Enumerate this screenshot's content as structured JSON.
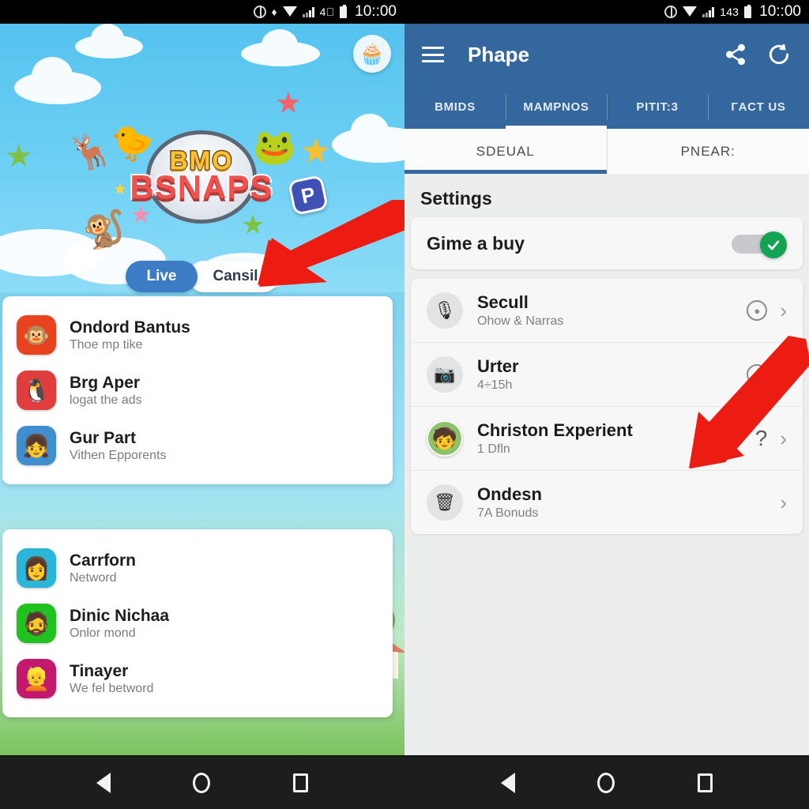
{
  "left": {
    "statusbar": {
      "network": "4⃣",
      "time": "10::00",
      "icons": [
        "globe-icon",
        "bluetooth-icon",
        "wifi-icon",
        "signal-icon"
      ]
    },
    "avatar_icon": "cupcake-avatar",
    "logo": {
      "top": "BMO",
      "bottom": "BSNAPS"
    },
    "pills": [
      {
        "label": "Live",
        "selected": true
      },
      {
        "label": "Cansil",
        "selected": false
      }
    ],
    "card1": [
      {
        "icon": "🐵",
        "bg": "#e8431f",
        "title": "Ondord Bantus",
        "subtitle": "Thoe mp tike"
      },
      {
        "icon": "🐧",
        "bg": "#e03e3e",
        "title": "Brg Aper",
        "subtitle": "logat the ads"
      },
      {
        "icon": "👧",
        "bg": "#3f8fd0",
        "title": "Gur Part",
        "subtitle": "Vithen Epporents"
      }
    ],
    "card2": [
      {
        "icon": "👩",
        "bg": "#29b6d8",
        "title": "Carrforn",
        "subtitle": "Netword"
      },
      {
        "icon": "🧔",
        "bg": "#1fc21f",
        "title": "Dinic Nichaa",
        "subtitle": "Onlor mond"
      },
      {
        "icon": "👱",
        "bg": "#c2186e",
        "title": "Tinayer",
        "subtitle": "We fel betword"
      }
    ],
    "navbar": [
      "back-button",
      "home-button",
      "recents-button"
    ]
  },
  "right": {
    "statusbar": {
      "network": "143",
      "time": "10::00",
      "icons": [
        "globe-icon",
        "wifi-icon",
        "signal-icon"
      ]
    },
    "appbar": {
      "menu_icon": "hamburger-menu-icon",
      "title": "Phape",
      "share_icon": "share-icon",
      "refresh_icon": "refresh-icon"
    },
    "tabs_primary": [
      {
        "label": "BMIDS",
        "selected": false
      },
      {
        "label": "MAMPNOS",
        "selected": true
      },
      {
        "label": "PITIT:3",
        "selected": false
      },
      {
        "label": "ГACT US",
        "selected": false
      }
    ],
    "tabs_secondary": [
      {
        "label": "SDEUAL",
        "selected": true
      },
      {
        "label": "PNEAR:",
        "selected": false
      }
    ],
    "section_title": "Settings",
    "toggle_row": {
      "label": "Gime a buy",
      "state": "on",
      "accent": "#13a453"
    },
    "rows": [
      {
        "icon": "🎙",
        "avatar": false,
        "title": "Secull",
        "subtitle": "Ohow & Narras",
        "end": "info"
      },
      {
        "icon": "📷",
        "avatar": false,
        "title": "Urter",
        "subtitle": "4÷15h",
        "end": "info"
      },
      {
        "icon": "🧒",
        "avatar": true,
        "title": "Christon Experient",
        "subtitle": "1 Dfln",
        "end": "question"
      },
      {
        "icon": "🗑",
        "avatar": false,
        "title": "Ondesn",
        "subtitle": "7A Bonuds",
        "end": "none"
      }
    ],
    "navbar": [
      "back-button",
      "home-button",
      "recents-button"
    ]
  },
  "annotations": {
    "arrow_color": "#ec1c12",
    "arrow_count": 2
  }
}
